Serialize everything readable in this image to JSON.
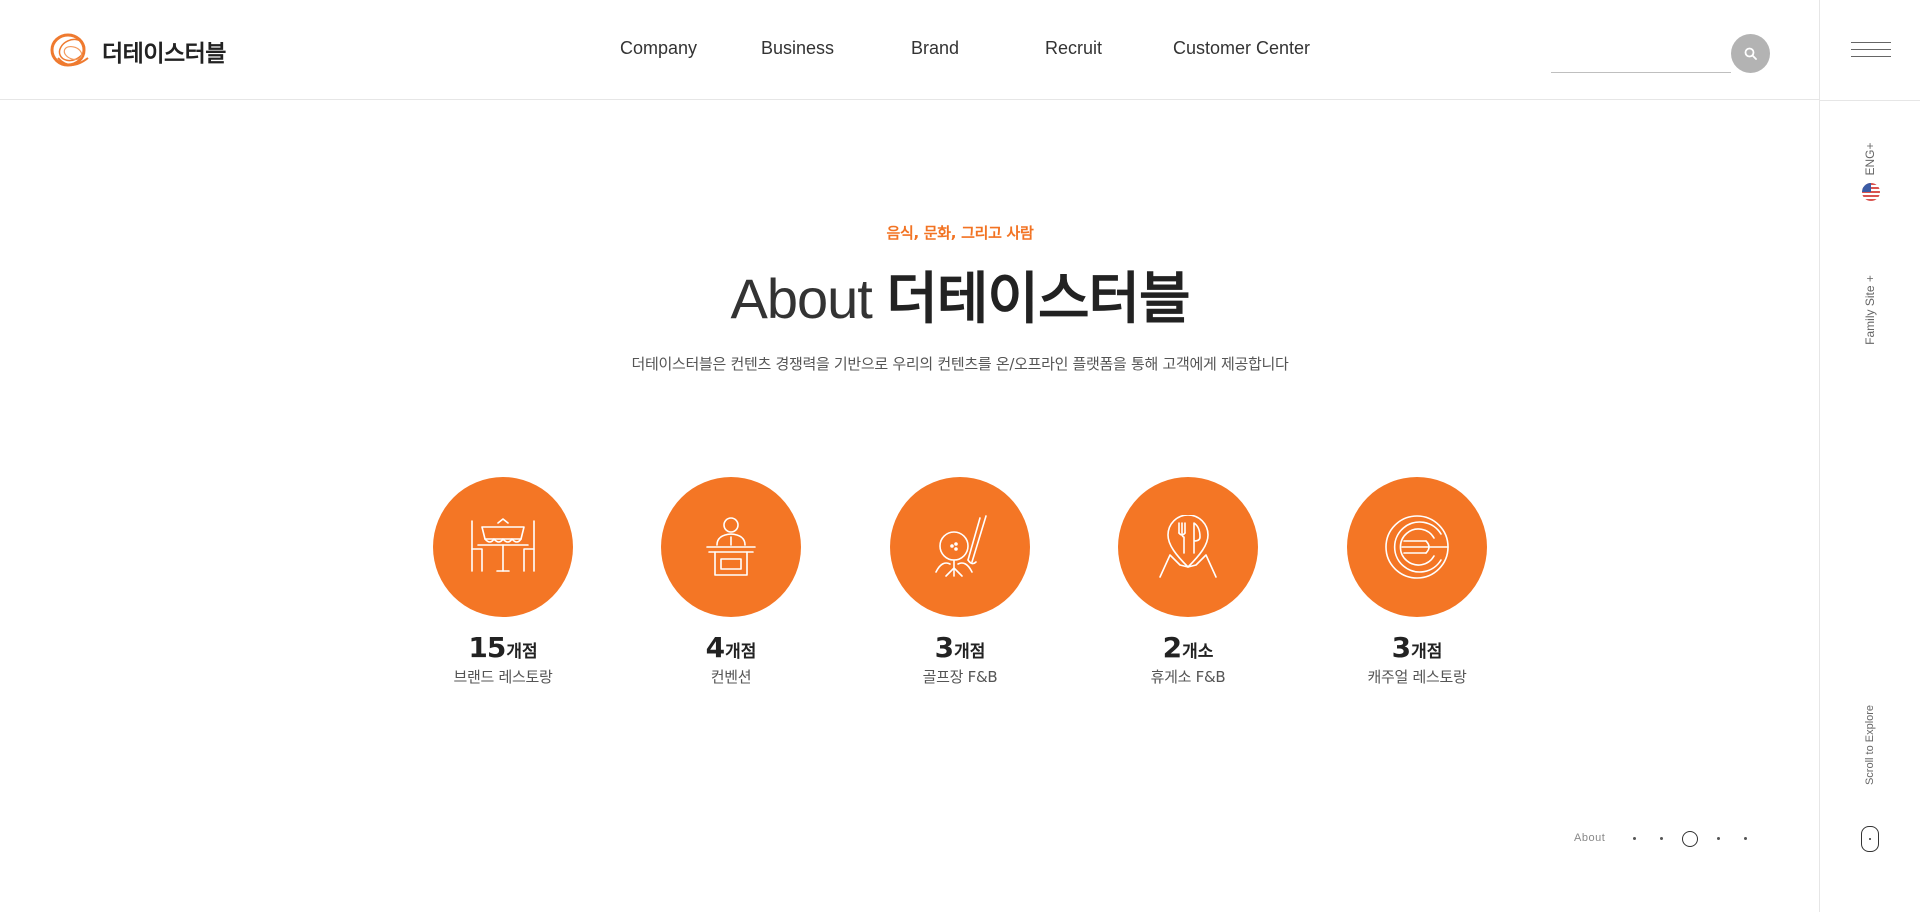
{
  "brand": {
    "name": "더테이스터블"
  },
  "nav": {
    "items": [
      {
        "label": "Company"
      },
      {
        "label": "Business"
      },
      {
        "label": "Brand"
      },
      {
        "label": "Recruit"
      },
      {
        "label": "Customer Center"
      }
    ]
  },
  "search": {
    "value": "",
    "icon": "search-icon"
  },
  "rail": {
    "language_label": "ENG+",
    "family_site_label": "Family Site +",
    "scroll_label": "Scroll to Explore"
  },
  "main": {
    "eyebrow": "음식, 문화, 그리고 사람",
    "title_en": "About",
    "title_ko": "더테이스터블",
    "description": "더테이스터블은 컨텐츠 경쟁력을 기반으로 우리의 컨텐츠를 온/오프라인 플랫폼을 통해 고객에게 제공합니다"
  },
  "stats": [
    {
      "number": "15",
      "unit": "개점",
      "label": "브랜드 레스토랑",
      "icon": "restaurant-table-icon"
    },
    {
      "number": "4",
      "unit": "개점",
      "label": "컨벤션",
      "icon": "convention-podium-icon"
    },
    {
      "number": "3",
      "unit": "개점",
      "label": "골프장 F&B",
      "icon": "golf-icon"
    },
    {
      "number": "2",
      "unit": "개소",
      "label": "휴게소 F&B",
      "icon": "rest-area-pin-icon"
    },
    {
      "number": "3",
      "unit": "개점",
      "label": "캐주얼 레스토랑",
      "icon": "casual-dining-plate-icon"
    }
  ],
  "pager": {
    "label": "About",
    "total": 5,
    "active_index": 2
  },
  "colors": {
    "accent": "#f47625",
    "eyebrow": "#f27323",
    "text": "#222222",
    "muted": "#555555",
    "search_button": "#b3b3b3"
  }
}
